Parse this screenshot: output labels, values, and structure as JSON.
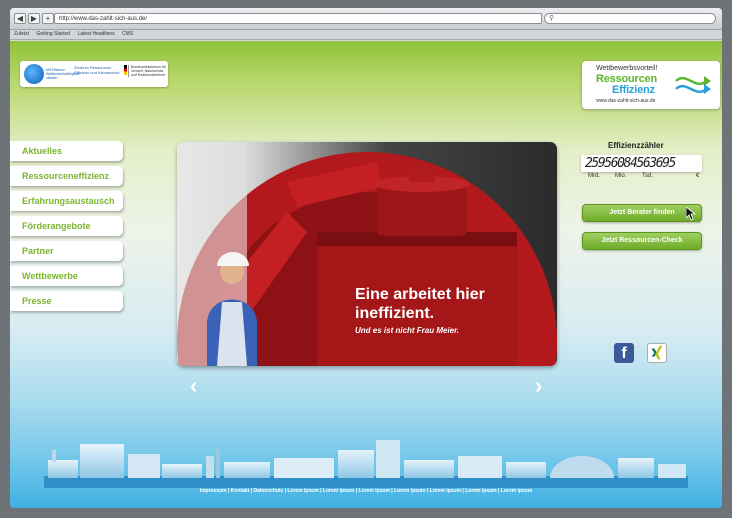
{
  "browser": {
    "url": "http://www.das-zahlt-sich-aus.de/",
    "search_placeholder": "",
    "nav_buttons": [
      "◀",
      "▶",
      "+"
    ],
    "bookmarks": [
      "Zuletzt",
      "Getting Started",
      "Latest Headlines",
      "CMS"
    ]
  },
  "logo": {
    "brand_text": "Mit Effizienz Wettbewerbsfähigkeit stärken",
    "center_text": "Zentrum Ressourcen Effizienz und Klimaschutz",
    "ministry_text": "Bundesministerium für Umwelt, Naturschutz und Reaktorsicherheit"
  },
  "campaign_logo": {
    "tagline": "Wettbewerbsvorteil!",
    "line1": "Ressourcen",
    "line2": "Effizienz",
    "url": "www.das-zahlt-sich-aus.de"
  },
  "nav": {
    "items": [
      {
        "label": "Aktuelles"
      },
      {
        "label": "Ressourceneffizienz"
      },
      {
        "label": "Erfahrungsaustausch"
      },
      {
        "label": "Förderangebote"
      },
      {
        "label": "Partner"
      },
      {
        "label": "Wettbewerbe"
      },
      {
        "label": "Presse"
      }
    ]
  },
  "hero": {
    "headline": "Eine arbeitet hier ineffizient.",
    "subline": "Und es ist nicht Frau Meier.",
    "prev": "‹",
    "next": "›"
  },
  "counter": {
    "title": "Effizienzzähler",
    "value": "25956084563695",
    "labels": [
      "Mrd.",
      "Mio.",
      "Tsd.",
      "€"
    ]
  },
  "buttons": {
    "berater": "Jetzt Berater finden",
    "check": "Jetzt Ressourcen-Check"
  },
  "social": {
    "facebook": "f"
  },
  "footer": {
    "links": "Impressum | Kontakt | Datenschutz | Lorem ipsum | Lorem ipsum | Lorem ipsum | Lorem ipsum | Lorem ipsum | Lorem ipsum | Lorem ipsum"
  },
  "colors": {
    "nav_text": "#7ab62e",
    "header_green": "#8fc23a",
    "hero_red": "#b81c1f",
    "facebook": "#3b5a9a"
  }
}
